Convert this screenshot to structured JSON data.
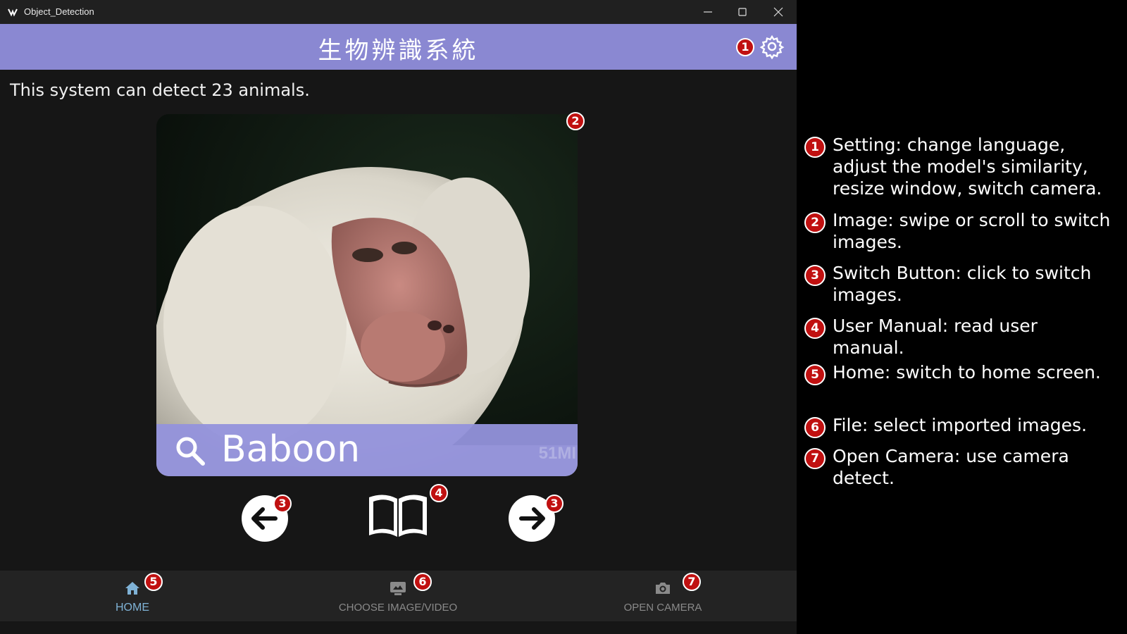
{
  "window": {
    "title": "Object_Detection"
  },
  "header": {
    "title": "生物辨識系統"
  },
  "main": {
    "subtitle": "This system can detect 23 animals.",
    "detection": {
      "label": "Baboon",
      "watermark": "51MI"
    }
  },
  "bottom_nav": [
    {
      "label": "HOME",
      "icon": "home-icon",
      "active": true,
      "color": "#7fb2d6"
    },
    {
      "label": "CHOOSE IMAGE/VIDEO",
      "icon": "image-icon",
      "active": false,
      "color": "#8a8a8a"
    },
    {
      "label": "OPEN CAMERA",
      "icon": "camera-icon",
      "active": false,
      "color": "#8a8a8a"
    }
  ],
  "badges": {
    "settings": "1",
    "image": "2",
    "prev": "3",
    "manual": "4",
    "next": "3",
    "home": "5",
    "file": "6",
    "camera": "7"
  },
  "legend": [
    {
      "num": "1",
      "text": "Setting: change language, adjust the model's similarity, resize window, switch camera."
    },
    {
      "num": "2",
      "text": "Image: swipe or scroll to switch images."
    },
    {
      "num": "3",
      "text": "Switch Button: click to switch images."
    },
    {
      "num": "4",
      "text": "User Manual: read user manual."
    },
    {
      "num": "5",
      "text": "Home: switch to home screen."
    },
    {
      "num": "6",
      "text": "File: select imported images."
    },
    {
      "num": "7",
      "text": "Open Camera: use camera detect."
    }
  ],
  "colors": {
    "header_bg": "#8a88d2",
    "label_bar": "#9492dc",
    "badge": "#c01010",
    "nav_bg": "#232323",
    "app_bg": "#161616"
  }
}
